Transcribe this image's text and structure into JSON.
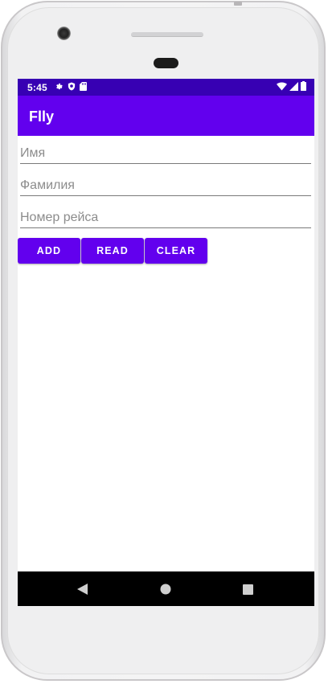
{
  "status_bar": {
    "time": "5:45",
    "left_icons": [
      "settings-icon",
      "shield-icon",
      "sd-card-icon"
    ],
    "right_icons": [
      "wifi-icon",
      "signal-icon",
      "battery-icon"
    ],
    "color": "#3700b3"
  },
  "app_bar": {
    "title": "Flly",
    "color": "#6200ee"
  },
  "form": {
    "first_name": {
      "placeholder": "Имя",
      "value": ""
    },
    "last_name": {
      "placeholder": "Фамилия",
      "value": ""
    },
    "flight_number": {
      "placeholder": "Номер рейса",
      "value": ""
    }
  },
  "buttons": {
    "add": "ADD",
    "read": "READ",
    "clear": "CLEAR",
    "color": "#6200ee"
  },
  "nav_bar": {
    "icons": [
      "back-icon",
      "home-icon",
      "recents-icon"
    ]
  }
}
